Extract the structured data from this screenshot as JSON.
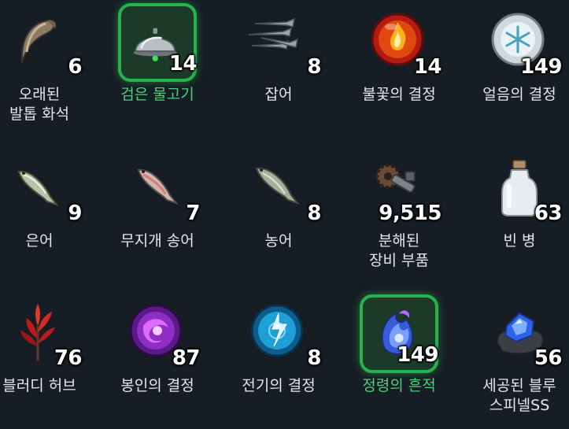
{
  "items": [
    {
      "name": "오래된\n발톱 화석",
      "count": "6",
      "selected": false,
      "icon": "claw-fossil-icon"
    },
    {
      "name": "검은 물고기",
      "count": "14",
      "selected": true,
      "icon": "cloche-icon"
    },
    {
      "name": "잡어",
      "count": "8",
      "selected": false,
      "icon": "small-fish-icon"
    },
    {
      "name": "불꽃의 결정",
      "count": "14",
      "selected": false,
      "icon": "fire-crystal-icon"
    },
    {
      "name": "얼음의 결정",
      "count": "149",
      "selected": false,
      "icon": "ice-crystal-icon"
    },
    {
      "name": "은어",
      "count": "9",
      "selected": false,
      "icon": "sweetfish-icon"
    },
    {
      "name": "무지개 송어",
      "count": "7",
      "selected": false,
      "icon": "rainbow-trout-icon"
    },
    {
      "name": "농어",
      "count": "8",
      "selected": false,
      "icon": "sea-bass-icon"
    },
    {
      "name": "분해된\n장비 부품",
      "count": "9,515",
      "selected": false,
      "icon": "gear-parts-icon"
    },
    {
      "name": "빈 병",
      "count": "63",
      "selected": false,
      "icon": "empty-bottle-icon"
    },
    {
      "name": "블러디 허브",
      "count": "76",
      "selected": false,
      "icon": "bloody-herb-icon"
    },
    {
      "name": "봉인의 결정",
      "count": "87",
      "selected": false,
      "icon": "seal-crystal-icon"
    },
    {
      "name": "전기의 결정",
      "count": "8",
      "selected": false,
      "icon": "electric-crystal-icon"
    },
    {
      "name": "정령의 흔적",
      "count": "149",
      "selected": true,
      "icon": "spirit-trace-icon"
    },
    {
      "name": "세공된 블루\n스피넬SS",
      "count": "56",
      "selected": false,
      "icon": "blue-spinel-icon"
    }
  ]
}
